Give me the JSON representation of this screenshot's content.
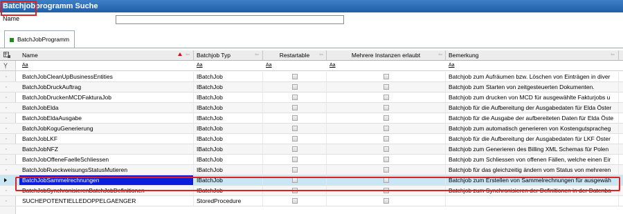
{
  "window": {
    "title": "Batchjobprogramm Suche"
  },
  "search": {
    "label": "Name",
    "value": ""
  },
  "tabs": [
    {
      "label": "BatchJobProgramm",
      "icon": "green-square-icon"
    }
  ],
  "table": {
    "columns": [
      {
        "label": "Name",
        "sorted": "ascending"
      },
      {
        "label": "Batchjob Typ"
      },
      {
        "label": "Restartable"
      },
      {
        "label": "Mehrere Instanzen erlaubt"
      },
      {
        "label": "Bemerkung"
      }
    ],
    "filter_placeholder": "Aa",
    "rows": [
      {
        "name": "BatchJobCleanUpBusinessEntities",
        "type": "IBatchJob",
        "restartable": false,
        "multi": false,
        "remark": "Batchjob zum Aufräumen bzw. Löschen von Einträgen in diver"
      },
      {
        "name": "BatchJobDruckAuftrag",
        "type": "IBatchJob",
        "restartable": false,
        "multi": false,
        "remark": "Batchjob zum Starten von zeitgesteuerten Dokumenten."
      },
      {
        "name": "BatchJobDruckenMCDFakturaJob",
        "type": "IBatchJob",
        "restartable": false,
        "multi": false,
        "remark": "Batchjob zum drucken von MCD für ausgewählte Fakturjobs u"
      },
      {
        "name": "BatchJobElda",
        "type": "IBatchJob",
        "restartable": false,
        "multi": false,
        "remark": "Batchjob für die Aufbereitung der Ausgabedaten für Elda Öster"
      },
      {
        "name": "BatchJobEldaAusgabe",
        "type": "IBatchJob",
        "restartable": false,
        "multi": false,
        "remark": "Batchjob für die Ausgabe der aufbereiteten Daten für Elda Öste"
      },
      {
        "name": "BatchJobKoguGenerierung",
        "type": "IBatchJob",
        "restartable": false,
        "multi": false,
        "remark": "Batchjob zum automatisch generieren von Kostengutspracheg"
      },
      {
        "name": "BatchJobLKF",
        "type": "IBatchJob",
        "restartable": false,
        "multi": false,
        "remark": "Batchjob für die Aufbereitung der Ausgabedaten für LKF Öster"
      },
      {
        "name": "BatchJobNFZ",
        "type": "IBatchJob",
        "restartable": false,
        "multi": false,
        "remark": "Batchjob zum Generieren des Billing XML Schemas für Polen"
      },
      {
        "name": "BatchJobOffeneFaelleSchliessen",
        "type": "IBatchJob",
        "restartable": false,
        "multi": false,
        "remark": "Batchjob zum Schliessen von offenen Fällen, welche einen Eir"
      },
      {
        "name": "BatchJobRueckweisungsStatusMutieren",
        "type": "IBatchJob",
        "restartable": false,
        "multi": false,
        "remark": "Batchjob für das gleichzeitig ändern vom Status von mehreren"
      },
      {
        "name": "BatchJobSammelrechnungen",
        "type": "IBatchJob",
        "restartable": false,
        "multi": false,
        "remark": "Batchjob zum Erstellen von Sammelrechnungen für ausgewäh",
        "selected": true
      },
      {
        "name": "BatchJobSynchronisierenBatchJobDefinitionen",
        "type": "IBatchJob",
        "restartable": false,
        "multi": false,
        "remark": "Batchjob zum Synchronisieren der Definitionen in der Datenba"
      },
      {
        "name": "SUCHEPOTENTIELLEDOPPELGAENGER",
        "type": "StoredProcedure",
        "restartable": false,
        "multi": false,
        "remark": ""
      }
    ]
  },
  "colors": {
    "titlebar": "#1f5fa8",
    "selection": "#0a1edc",
    "row_highlight": "#c9e7f3",
    "annotation": "#e02020"
  }
}
